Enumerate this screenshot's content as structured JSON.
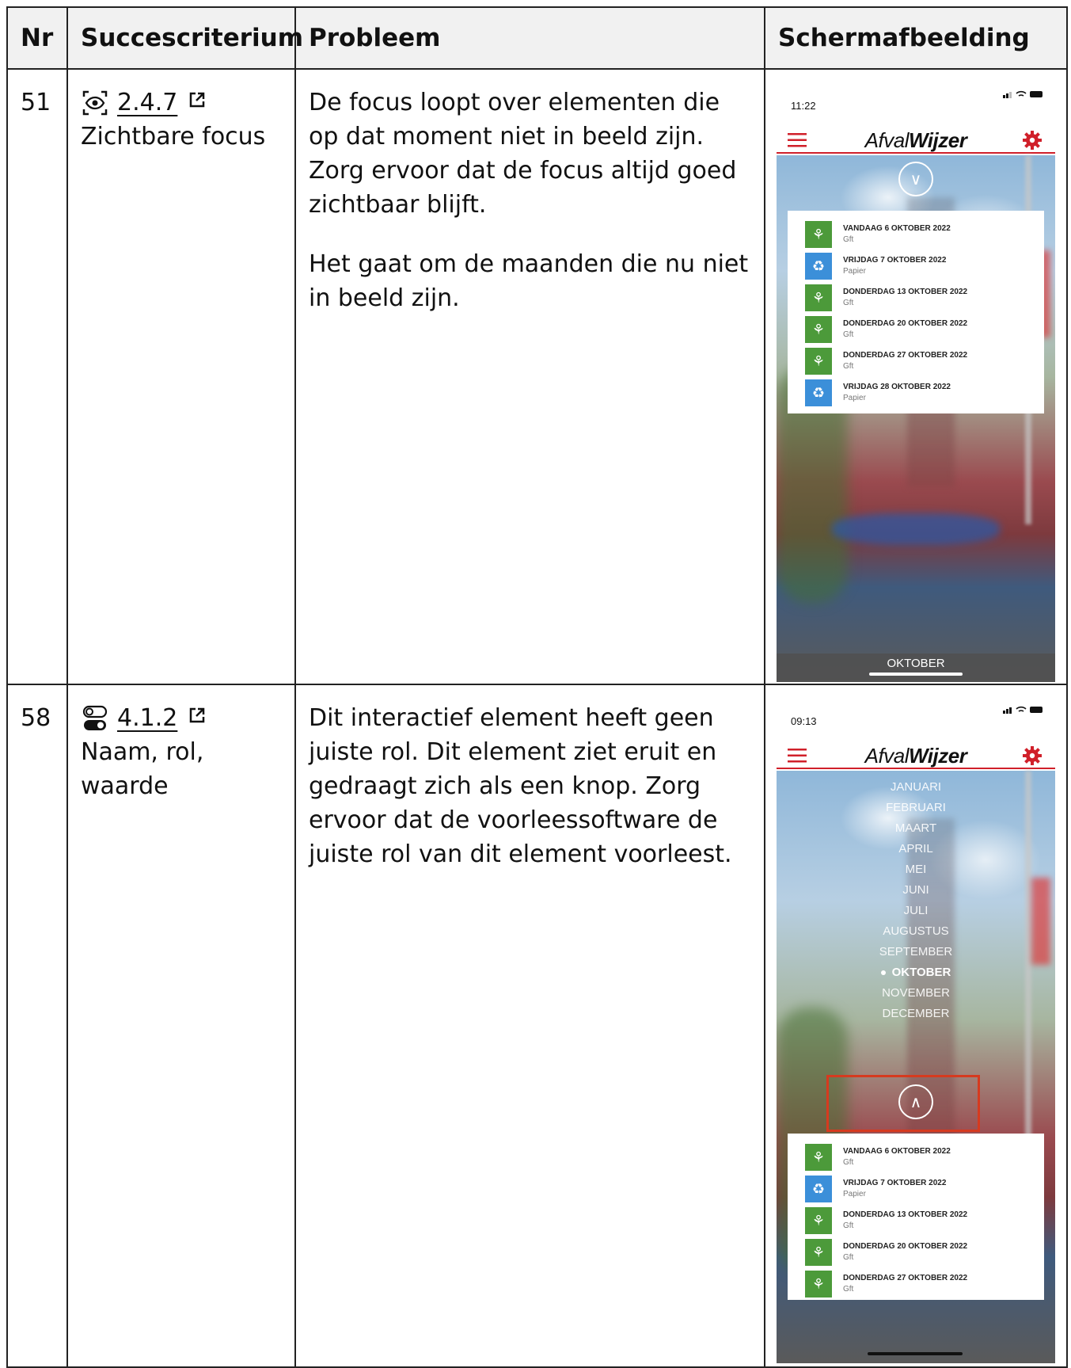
{
  "table": {
    "headers": {
      "nr": "Nr",
      "criterion": "Succescriterium",
      "problem": "Probleem",
      "screenshot": "Schermafbeelding"
    },
    "rows": [
      {
        "nr": "51",
        "criterion_code": "2.4.7",
        "criterion_name": "Zichtbare focus",
        "criterion_icon": "eye-focus-icon",
        "problem_paragraphs": [
          "De focus loopt over elementen die op dat moment niet in beeld zijn. Zorg ervoor dat de focus altijd goed zichtbaar blijft.",
          "Het gaat om de maanden die nu niet in beeld zijn."
        ],
        "screenshot": {
          "time": "11:22",
          "logo_light": "Afval",
          "logo_bold": "Wijzer",
          "items": [
            {
              "date": "VANDAAG 6 OKTOBER 2022",
              "type": "Gft",
              "color": "#4c9a3a"
            },
            {
              "date": "VRIJDAG 7 OKTOBER 2022",
              "type": "Papier",
              "color": "#3b8fd9"
            },
            {
              "date": "DONDERDAG 13 OKTOBER 2022",
              "type": "Gft",
              "color": "#4c9a3a"
            },
            {
              "date": "DONDERDAG 20 OKTOBER 2022",
              "type": "Gft",
              "color": "#4c9a3a"
            },
            {
              "date": "DONDERDAG 27 OKTOBER 2022",
              "type": "Gft",
              "color": "#4c9a3a"
            },
            {
              "date": "VRIJDAG 28 OKTOBER 2022",
              "type": "Papier",
              "color": "#3b8fd9"
            }
          ],
          "month_bar": "OKTOBER"
        }
      },
      {
        "nr": "58",
        "criterion_code": "4.1.2",
        "criterion_name": "Naam, rol, waarde",
        "criterion_icon": "toggle-switch-icon",
        "problem_paragraphs": [
          "Dit interactief element heeft geen juiste rol. Dit element ziet eruit en gedraagt zich als een knop. Zorg ervoor dat de voorleessoftware de juiste rol van dit element voorleest."
        ],
        "screenshot": {
          "time": "09:13",
          "logo_light": "Afval",
          "logo_bold": "Wijzer",
          "months": [
            "JANUARI",
            "FEBRUARI",
            "MAART",
            "APRIL",
            "MEI",
            "JUNI",
            "JULI",
            "AUGUSTUS",
            "SEPTEMBER",
            "OKTOBER",
            "NOVEMBER",
            "DECEMBER"
          ],
          "active_month": "OKTOBER",
          "items": [
            {
              "date": "VANDAAG 6 OKTOBER 2022",
              "type": "Gft",
              "color": "#4c9a3a"
            },
            {
              "date": "VRIJDAG 7 OKTOBER 2022",
              "type": "Papier",
              "color": "#3b8fd9"
            },
            {
              "date": "DONDERDAG 13 OKTOBER 2022",
              "type": "Gft",
              "color": "#4c9a3a"
            },
            {
              "date": "DONDERDAG 20 OKTOBER 2022",
              "type": "Gft",
              "color": "#4c9a3a"
            },
            {
              "date": "DONDERDAG 27 OKTOBER 2022",
              "type": "Gft",
              "color": "#4c9a3a"
            }
          ]
        }
      }
    ]
  },
  "colors": {
    "brand_red": "#d0202a",
    "focus_outline": "#d63a1f",
    "gft_green": "#4c9a3a",
    "paper_blue": "#3b8fd9"
  }
}
